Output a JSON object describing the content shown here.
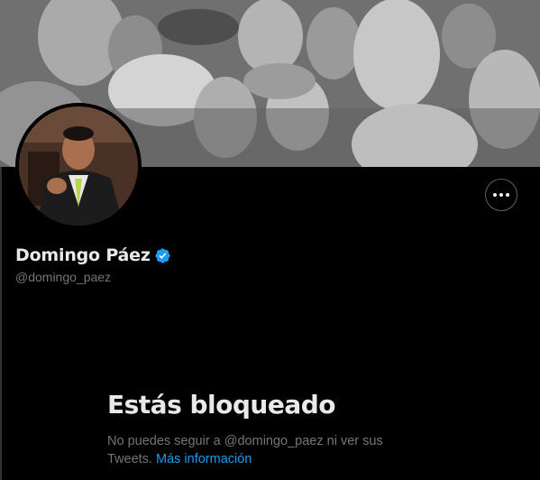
{
  "profile": {
    "display_name": "Domingo Páez",
    "handle": "@domingo_paez",
    "verified": true
  },
  "actions": {
    "more_label": "Más"
  },
  "blocked": {
    "title": "Estás bloqueado",
    "description": "No puedes seguir a @domingo_paez ni ver sus Tweets.",
    "link_label": "Más información"
  },
  "colors": {
    "background": "#000000",
    "text_primary": "#e7e9ea",
    "text_secondary": "#71767b",
    "accent": "#1d9bf0"
  },
  "icons": {
    "more": "more-horizontal-icon",
    "verified": "verified-badge-icon"
  }
}
